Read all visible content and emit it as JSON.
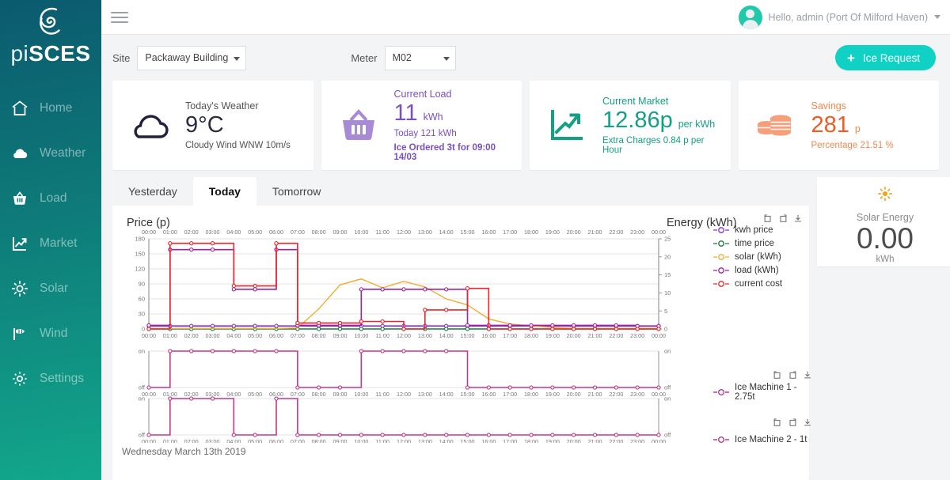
{
  "brand": {
    "prefix": "pi",
    "suffix": "SCES"
  },
  "sidebar": {
    "items": [
      {
        "label": "Home",
        "icon": "home-icon"
      },
      {
        "label": "Weather",
        "icon": "cloud-icon"
      },
      {
        "label": "Load",
        "icon": "basket-icon"
      },
      {
        "label": "Market",
        "icon": "chart-line-icon"
      },
      {
        "label": "Solar",
        "icon": "sun-icon"
      },
      {
        "label": "Wind",
        "icon": "windsock-icon"
      },
      {
        "label": "Settings",
        "icon": "gear-icon"
      }
    ]
  },
  "topbar": {
    "menu_icon": "hamburger-icon",
    "user_greeting": "Hello, admin (Port Of Milford Haven)"
  },
  "filters": {
    "site_label": "Site",
    "site_value": "Packaway Building",
    "meter_label": "Meter",
    "meter_value": "M02",
    "ice_request_label": "Ice Request",
    "ice_request_plus": "+"
  },
  "kpis": [
    {
      "icon": "cloud-icon",
      "title": "Today's Weather",
      "value": "9°C",
      "unit": "",
      "sub": "Cloudy Wind WNW 10m/s",
      "sub2": "",
      "color": "#2b2b45"
    },
    {
      "icon": "basket-icon",
      "title": "Current Load",
      "value": "11",
      "unit": "kWh",
      "sub": "Today 121 kWh",
      "sub2": "Ice Ordered 3t for 09:00 14/03",
      "color": "#7a4fc0"
    },
    {
      "icon": "chart-line-icon",
      "title": "Current Market",
      "value": "12.86p",
      "unit": "per kWh",
      "sub": "Extra Charges 0.84 p per Hour",
      "sub2": "",
      "color": "#13a085"
    },
    {
      "icon": "coins-icon",
      "title": "Savings",
      "value": "281",
      "unit": "p",
      "sub": "Percentage 21.51 %",
      "sub2": "",
      "color": "#ef5b25"
    }
  ],
  "tabs": [
    {
      "label": "Yesterday",
      "active": false
    },
    {
      "label": "Today",
      "active": true
    },
    {
      "label": "Tomorrow",
      "active": false
    }
  ],
  "solar_panel": {
    "icon": "sun-icon",
    "title": "Solar Energy",
    "value": "0.00",
    "unit": "kWh"
  },
  "chart_toolbar": {
    "icons": [
      "rotate-left-icon",
      "rotate-right-icon",
      "download-icon"
    ]
  },
  "footer": {
    "date": "Wednesday March 13th 2019"
  },
  "chart_data": [
    {
      "id": "main",
      "type": "line",
      "title": "",
      "ylabel": "Price (p)",
      "y2label": "Energy (kWh)",
      "xlabel": "",
      "grid": true,
      "legend_position": "right",
      "ylim": [
        0,
        180
      ],
      "yticks": [
        0,
        30,
        60,
        90,
        120,
        150,
        180
      ],
      "y2lim": [
        0,
        25
      ],
      "y2ticks": [
        0,
        5,
        10,
        15,
        20,
        25
      ],
      "x": [
        "00:00",
        "01:00",
        "02:00",
        "03:00",
        "04:00",
        "05:00",
        "06:00",
        "07:00",
        "08:00",
        "09:00",
        "10:00",
        "11:00",
        "12:00",
        "13:00",
        "14:00",
        "15:00",
        "16:00",
        "17:00",
        "18:00",
        "19:00",
        "20:00",
        "21:00",
        "22:00",
        "23:00",
        "00:00"
      ],
      "series": [
        {
          "name": "kwh price",
          "color": "#8a2be2",
          "axis": "left",
          "step": true,
          "values": [
            6,
            6,
            6,
            6,
            6,
            6,
            6,
            6,
            6,
            6,
            6,
            6,
            6,
            6,
            6,
            6,
            6,
            6,
            6,
            6,
            6,
            6,
            6,
            6,
            6
          ]
        },
        {
          "name": "time price",
          "color": "#1a7a3c",
          "axis": "left",
          "step": true,
          "values": [
            0,
            0,
            0,
            0,
            0,
            0,
            0,
            0,
            0,
            0,
            0,
            0,
            0,
            0,
            0,
            0,
            0,
            0,
            0,
            0,
            0,
            0,
            0,
            0,
            0
          ]
        },
        {
          "name": "solar (kWh)",
          "color": "#f0ad33",
          "axis": "left",
          "step": false,
          "values": [
            1,
            1,
            1,
            1,
            1,
            1,
            1,
            2,
            40,
            88,
            100,
            82,
            95,
            84,
            60,
            48,
            20,
            10,
            6,
            3,
            1,
            1,
            1,
            1,
            1
          ]
        },
        {
          "name": "load (kWh)",
          "color": "#a020a0",
          "axis": "right",
          "step": true,
          "values": [
            1,
            22,
            22,
            22,
            11,
            11,
            22,
            1,
            1,
            1,
            11,
            11,
            11,
            11,
            11,
            1,
            1,
            1,
            1,
            1,
            1,
            1,
            1,
            0.8,
            0.8
          ]
        },
        {
          "name": "current cost",
          "color": "#e8262b",
          "axis": "left",
          "step": true,
          "values": [
            0,
            171,
            171,
            171,
            86,
            86,
            171,
            12,
            12,
            12,
            15,
            15,
            0,
            38,
            38,
            81,
            0,
            0,
            0,
            0,
            0,
            0,
            0,
            0,
            0
          ]
        }
      ]
    },
    {
      "id": "ice-machine-1",
      "type": "step",
      "ylabel": "",
      "ytick_labels": [
        "off",
        "on"
      ],
      "legend_label": "Ice Machine 1 - 2.75t",
      "color": "#c0398a",
      "x": [
        "00:00",
        "01:00",
        "02:00",
        "03:00",
        "04:00",
        "05:00",
        "06:00",
        "07:00",
        "08:00",
        "09:00",
        "10:00",
        "11:00",
        "12:00",
        "13:00",
        "14:00",
        "15:00",
        "16:00",
        "17:00",
        "18:00",
        "19:00",
        "20:00",
        "21:00",
        "22:00",
        "23:00",
        "00:00"
      ],
      "values": [
        0,
        1,
        1,
        1,
        1,
        1,
        1,
        0,
        0,
        0,
        1,
        1,
        1,
        1,
        1,
        0,
        0,
        0,
        0,
        0,
        0,
        0,
        0,
        0,
        0
      ]
    },
    {
      "id": "ice-machine-2",
      "type": "step",
      "ylabel": "",
      "ytick_labels": [
        "off",
        "on"
      ],
      "legend_label": "Ice Machine 2 - 1t",
      "color": "#c0398a",
      "x": [
        "00:00",
        "01:00",
        "02:00",
        "03:00",
        "04:00",
        "05:00",
        "06:00",
        "07:00",
        "08:00",
        "09:00",
        "10:00",
        "11:00",
        "12:00",
        "13:00",
        "14:00",
        "15:00",
        "16:00",
        "17:00",
        "18:00",
        "19:00",
        "20:00",
        "21:00",
        "22:00",
        "23:00",
        "00:00"
      ],
      "values": [
        0,
        1,
        1,
        1,
        0,
        0,
        1,
        0,
        0,
        0,
        0,
        0,
        0,
        0,
        0,
        0,
        0,
        0,
        0,
        0,
        0,
        0,
        0,
        0,
        0
      ]
    }
  ]
}
